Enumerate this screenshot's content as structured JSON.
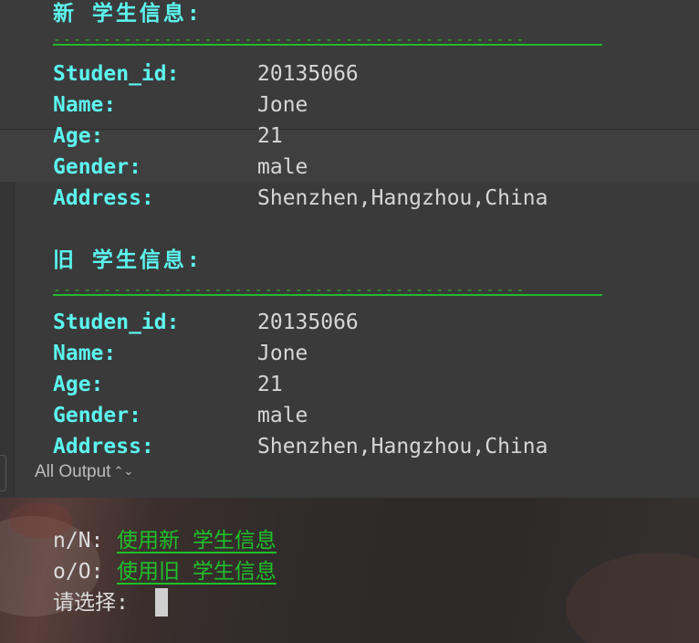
{
  "new_section": {
    "heading": "新 学生信息:",
    "divider": "-----------------------------------------------",
    "fields": [
      {
        "key": "Studen_id:",
        "value": "20135066"
      },
      {
        "key": "Name:",
        "value": "Jone"
      },
      {
        "key": "Age:",
        "value": "21"
      },
      {
        "key": "Gender:",
        "value": "male"
      },
      {
        "key": "Address:",
        "value": "Shenzhen,Hangzhou,China"
      }
    ]
  },
  "old_section": {
    "heading": "旧 学生信息:",
    "divider": "-----------------------------------------------",
    "fields": [
      {
        "key": "Studen_id:",
        "value": "20135066"
      },
      {
        "key": "Name:",
        "value": "Jone"
      },
      {
        "key": "Age:",
        "value": "21"
      },
      {
        "key": "Gender:",
        "value": "male"
      },
      {
        "key": "Address:",
        "value": "Shenzhen,Hangzhou,China"
      }
    ]
  },
  "console_bar": {
    "filter_label": "All Output",
    "filter_icon": "up-down-chevron-icon"
  },
  "terminal": {
    "options": [
      {
        "key": "n/N: ",
        "label": "使用新 学生信息"
      },
      {
        "key": "o/O: ",
        "label": "使用旧 学生信息"
      }
    ],
    "prompt": "请选择:"
  },
  "colors": {
    "heading": "#5cf5ef",
    "divider": "#24b82b",
    "option_link": "#1fc02a",
    "value_text": "#d6d6d6"
  }
}
